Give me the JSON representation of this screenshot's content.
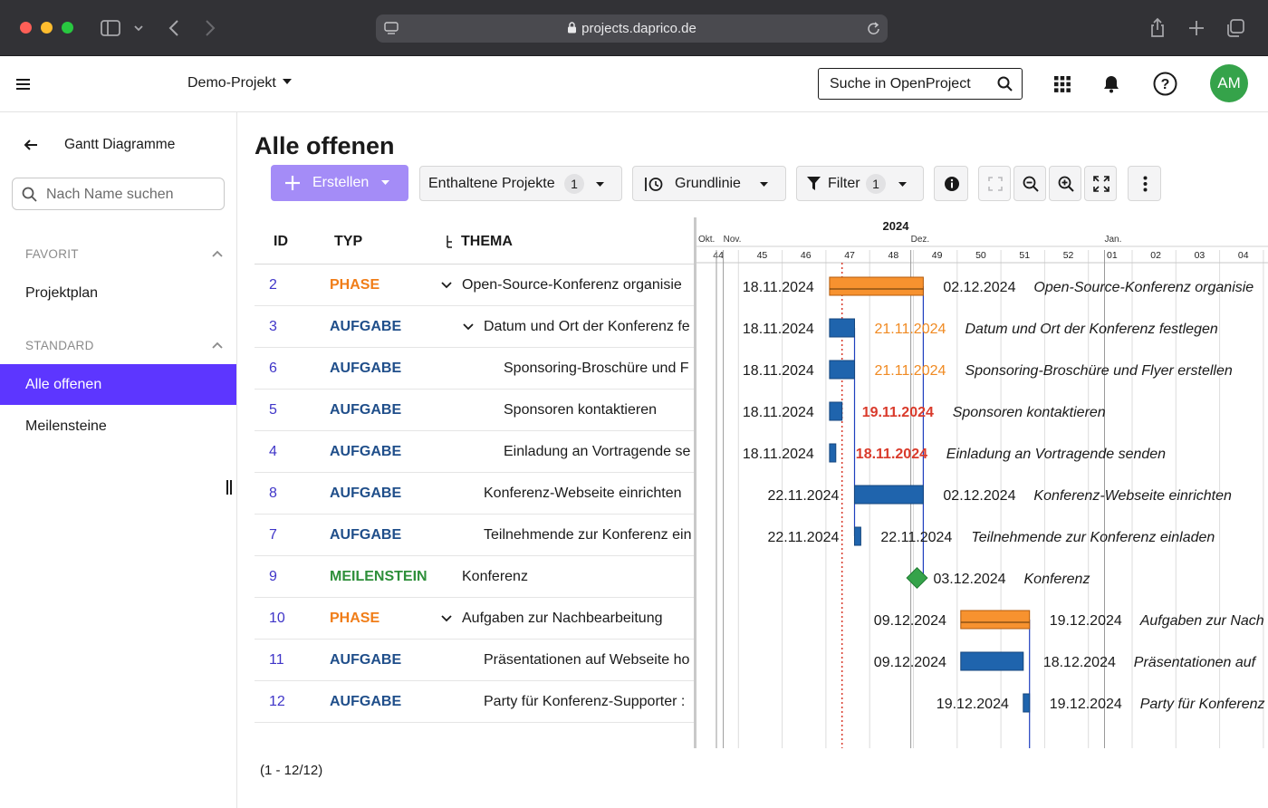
{
  "browser": {
    "url": "projects.daprico.de"
  },
  "header": {
    "project": "Demo-Projekt",
    "search_label": "Suche in OpenProject",
    "avatar_initials": "AM"
  },
  "sidebar": {
    "title": "Gantt Diagramme",
    "search_placeholder": "Nach Name suchen",
    "sections": [
      {
        "label": "FAVORIT",
        "items": [
          "Projektplan"
        ]
      },
      {
        "label": "STANDARD",
        "items": [
          "Alle offenen",
          "Meilensteine"
        ]
      }
    ],
    "active": "Alle offenen"
  },
  "main": {
    "title": "Alle offenen",
    "toolbar": {
      "create": "Erstellen",
      "included_projects": "Enthaltene Projekte",
      "included_projects_count": "1",
      "baseline": "Grundlinie",
      "filter": "Filter",
      "filter_count": "1"
    },
    "columns": {
      "id": "ID",
      "type": "TYP",
      "subject": "THEMA"
    },
    "rows": [
      {
        "id": "2",
        "type": "PHASE",
        "subject": "Open-Source-Konferenz organisie",
        "indent": 0,
        "caret": true
      },
      {
        "id": "3",
        "type": "AUFGABE",
        "subject": "Datum und Ort der Konferenz fe",
        "indent": 1,
        "caret": true
      },
      {
        "id": "6",
        "type": "AUFGABE",
        "subject": "Sponsoring-Broschüre und F",
        "indent": 2,
        "caret": false
      },
      {
        "id": "5",
        "type": "AUFGABE",
        "subject": "Sponsoren kontaktieren",
        "indent": 2,
        "caret": false
      },
      {
        "id": "4",
        "type": "AUFGABE",
        "subject": "Einladung an Vortragende se",
        "indent": 2,
        "caret": false
      },
      {
        "id": "8",
        "type": "AUFGABE",
        "subject": "Konferenz-Webseite einrichten",
        "indent": 1,
        "caret": false
      },
      {
        "id": "7",
        "type": "AUFGABE",
        "subject": "Teilnehmende zur Konferenz ein",
        "indent": 1,
        "caret": false
      },
      {
        "id": "9",
        "type": "MEILENSTEIN",
        "subject": "Konferenz",
        "indent": 0,
        "caret": false
      },
      {
        "id": "10",
        "type": "PHASE",
        "subject": "Aufgaben zur Nachbearbeitung",
        "indent": 0,
        "caret": true
      },
      {
        "id": "11",
        "type": "AUFGABE",
        "subject": "Präsentationen auf Webseite ho",
        "indent": 1,
        "caret": false
      },
      {
        "id": "12",
        "type": "AUFGABE",
        "subject": "Party für Konferenz-Supporter :",
        "indent": 1,
        "caret": false
      }
    ],
    "count_label": "(1 - 12/12)"
  },
  "gantt": {
    "year": "2024",
    "months": [
      "Okt.",
      "Nov.",
      "Dez.",
      "Jan."
    ],
    "weeks": [
      "44",
      "45",
      "46",
      "47",
      "48",
      "49",
      "50",
      "51",
      "52",
      "01",
      "02",
      "03",
      "04"
    ],
    "bars": [
      {
        "start": "18.11.2024",
        "end": "02.12.2024",
        "label": "Open-Source-Konferenz organisie",
        "kind": "phase",
        "end_status": "normal"
      },
      {
        "start": "18.11.2024",
        "end": "21.11.2024",
        "label": "Datum und Ort der Konferenz festlegen",
        "kind": "task",
        "end_status": "warning"
      },
      {
        "start": "18.11.2024",
        "end": "21.11.2024",
        "label": "Sponsoring-Broschüre und Flyer erstellen",
        "kind": "task",
        "end_status": "warning"
      },
      {
        "start": "18.11.2024",
        "end": "19.11.2024",
        "label": "Sponsoren kontaktieren",
        "kind": "task",
        "end_status": "overdue"
      },
      {
        "start": "18.11.2024",
        "end": "18.11.2024",
        "label": "Einladung an Vortragende senden",
        "kind": "task",
        "end_status": "overdue"
      },
      {
        "start": "22.11.2024",
        "end": "02.12.2024",
        "label": "Konferenz-Webseite einrichten",
        "kind": "task",
        "end_status": "normal"
      },
      {
        "start": "22.11.2024",
        "end": "22.11.2024",
        "label": "Teilnehmende zur Konferenz einladen",
        "kind": "task",
        "end_status": "normal"
      },
      {
        "start": "",
        "end": "03.12.2024",
        "label": "Konferenz",
        "kind": "milestone",
        "end_status": "normal"
      },
      {
        "start": "09.12.2024",
        "end": "19.12.2024",
        "label": "Aufgaben zur Nach",
        "kind": "phase",
        "end_status": "normal"
      },
      {
        "start": "09.12.2024",
        "end": "18.12.2024",
        "label": "Präsentationen auf",
        "kind": "task",
        "end_status": "normal"
      },
      {
        "start": "19.12.2024",
        "end": "19.12.2024",
        "label": "Party für Konferenz",
        "kind": "task",
        "end_status": "normal"
      }
    ],
    "colors": {
      "phase": "#f7922f",
      "task": "#1f64ad",
      "milestone": "#35a34a",
      "warning": "#f08a22",
      "overdue": "#d93a2b",
      "today": "#d93a2b"
    }
  }
}
